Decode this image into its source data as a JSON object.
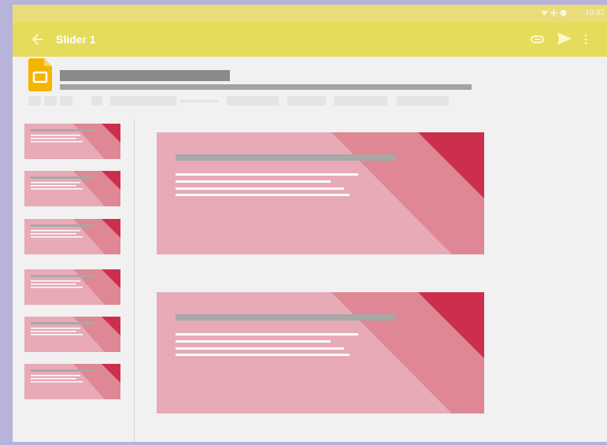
{
  "status_bar": {
    "time": "10:47"
  },
  "app_bar": {
    "title": "Slider 1"
  },
  "colors": {
    "app_bar": "#e6dc5c",
    "status_bar": "#e8dd78",
    "slide_base": "#e8aab7",
    "slide_mid": "#df8794",
    "slide_accent": "#cb2f4d",
    "docs_logo": "#f4b400"
  },
  "icons": [
    "wifi-icon",
    "signal-icon",
    "battery-icon",
    "back-arrow-icon",
    "attach-icon",
    "send-icon",
    "more-vert-icon",
    "slides-logo-icon"
  ],
  "thumbnails_count": 6,
  "slides_count": 2
}
